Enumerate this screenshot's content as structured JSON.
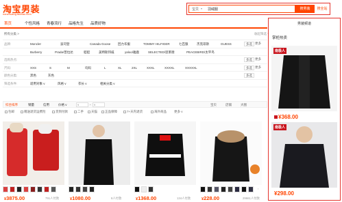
{
  "header": {
    "logo": "淘宝男装",
    "logo_sub": "nanzhuang.taobao.com",
    "search_scope": "宝贝",
    "search_value": "羽绒服",
    "search_button": "搜男装",
    "search_button2": "搜全站"
  },
  "nav": [
    "首页",
    "个性风格",
    "青春流行",
    "品格先生",
    "品质好物"
  ],
  "filters": {
    "crumb": "所有分类 >",
    "collapse": "收起筛选 ^",
    "rows": [
      {
        "label": "品牌:",
        "items": [
          "Moncler",
          "波司登",
          "Canada Goose",
          "回力华服",
          "TOMMY HILFIGER",
          "七匹狼",
          "杰克琼斯",
          "GUESS"
        ],
        "more": "多选",
        "more2": "更多"
      },
      {
        "label": "",
        "items": [
          "Burberry",
          "Prada/普拉达",
          "貂貂",
          "美特斯邦威",
          "yaloo/雅鹿",
          "SELECTED/思莱德",
          "PEACEBIRD/太平鸟"
        ],
        "more": "",
        "more2": ""
      },
      {
        "label": "选购热点:",
        "items": [
          "",
          "",
          "",
          "",
          "",
          "",
          "",
          ""
        ],
        "more": "多选",
        "more2": "更多"
      },
      {
        "label": "尺码:",
        "items": [
          "XXS",
          "S",
          "M",
          "均码",
          "L",
          "XL",
          "2XL",
          "XXXL",
          "XXXXL",
          "XXXXXL"
        ],
        "more": "多选",
        "more2": "更多"
      },
      {
        "label": "颜色分类:",
        "items": [
          "黑色",
          "灰色"
        ],
        "more": "多选",
        "more2": ""
      },
      {
        "label": "筛选条件:",
        "items": [
          "适用对象 v",
          "风格 v",
          "衣长 v",
          "相关分类 v"
        ],
        "more": "",
        "more2": ""
      }
    ]
  },
  "sortbar": {
    "items": [
      "综合排序",
      "销量",
      "信用",
      "价格 v"
    ],
    "price_from": "¥",
    "price_to": "¥",
    "view": [
      "宝贝",
      "店铺",
      "大图"
    ]
  },
  "options": [
    "包邮",
    "赠送退货运费险",
    "货到付款",
    "二手",
    "天猫",
    "正品保障",
    "7+天内退货",
    "海外商品",
    "更多 v"
  ],
  "products": [
    {
      "price": "3875.00",
      "sales": "791人付款",
      "img": "#f2eee9"
    },
    {
      "price": "1080.00",
      "sales": "8人付款",
      "img": "#ececec"
    },
    {
      "price": "1368.00",
      "sales": "134人付款",
      "img": "#f6f6f6"
    },
    {
      "price": "228.00",
      "sales": "29661人付款",
      "img": "#fbfbfb"
    }
  ],
  "right_panel": {
    "head": "男装频道",
    "title": "掌柜热卖",
    "ads": [
      {
        "brand": "南极人",
        "price": "368.00"
      },
      {
        "brand": "南极人",
        "price": "298.00"
      }
    ]
  }
}
